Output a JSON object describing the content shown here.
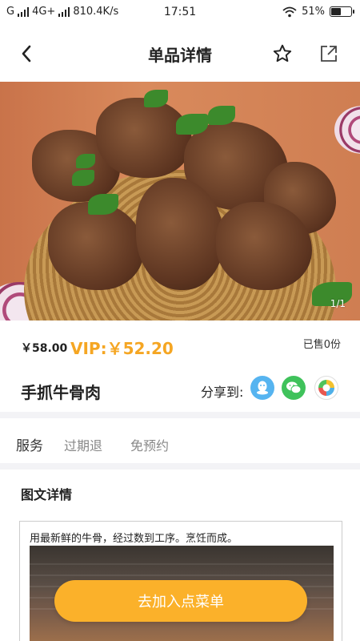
{
  "status_bar": {
    "carrier": "G",
    "network": "4G+",
    "speed": "810.4K/s",
    "time": "17:51",
    "battery_pct": "51%",
    "battery_level": 0.51
  },
  "nav": {
    "title": "单品详情",
    "icons": {
      "back": "chevron-left-icon",
      "favorite": "star-icon",
      "share": "share-icon"
    }
  },
  "gallery": {
    "indicator": "1/1"
  },
  "price": {
    "original": "￥58.00",
    "vip": "VIP:￥52.20",
    "sold": "已售0份"
  },
  "product": {
    "title": "手抓牛骨肉",
    "share_label": "分享到:",
    "share_targets": [
      "qq-icon",
      "wechat-icon",
      "moments-icon"
    ]
  },
  "services": {
    "label": "服务",
    "tags": [
      "过期退",
      "免预约"
    ]
  },
  "detail": {
    "heading": "图文详情",
    "description": "用最新鲜的牛骨，经过数到工序。烹饪而成。"
  },
  "actions": {
    "add_to_order": "去加入点菜单"
  },
  "colors": {
    "accent": "#f5a623",
    "button": "#fbb12a",
    "qq": "#56b4f0",
    "wechat": "#3fc25b"
  }
}
